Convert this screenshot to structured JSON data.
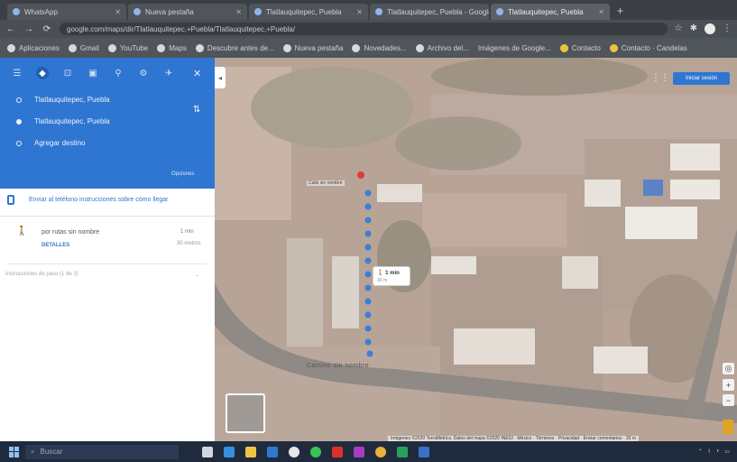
{
  "browser": {
    "tabs": [
      {
        "label": "WhatsApp",
        "active": false
      },
      {
        "label": "Nueva pestaña",
        "active": false
      },
      {
        "label": "Tlatlauquitepec, Puebla",
        "active": false
      },
      {
        "label": "Tlatlauquitepec, Puebla - Google Maps",
        "active": false
      },
      {
        "label": "Tlatlauquitepec, Puebla",
        "active": true
      }
    ],
    "url": "google.com/maps/dir/Tlatlauquitepec,+Puebla/Tlatlauquitepec,+Puebla/",
    "bookmarks": [
      "Aplicaciones",
      "Gmail",
      "YouTube",
      "Maps",
      "Descubre antes de...",
      "Nueva pestaña",
      "Novedades...",
      "Archivo del...",
      "Imágenes de Google...",
      "Contacto",
      "Contacto · Candelas"
    ]
  },
  "panel": {
    "origin": "Tlatlauquitepec, Puebla",
    "destination": "Tlatlauquitepec, Puebla",
    "add_destination": "Agregar destino",
    "options": "Opciones",
    "send_to_phone": "Enviar al teléfono instrucciones sobre cómo llegar",
    "route_title": "por rutas sin nombre",
    "route_time": "1 min",
    "route_distance": "30 metros",
    "details": "DETALLES",
    "hint": "Instrucciones de paso (1 de 3)"
  },
  "map": {
    "signin": "Iniciar sesión",
    "info_time": "1 min",
    "info_dist": "30 m",
    "street_label": "Camino sin nombre",
    "street_small": "Calle sin nombre",
    "attribution": "Imágenes ©2020 TerraMetrics, Datos del mapa ©2020 INEGI · México · Términos · Privacidad · Enviar comentarios · 20 m"
  },
  "taskbar": {
    "search_placeholder": "Buscar"
  },
  "colors": {
    "panel_blue": "#2f76d2",
    "route_dot": "#3b7fd4",
    "dest_pin": "#e53935"
  }
}
